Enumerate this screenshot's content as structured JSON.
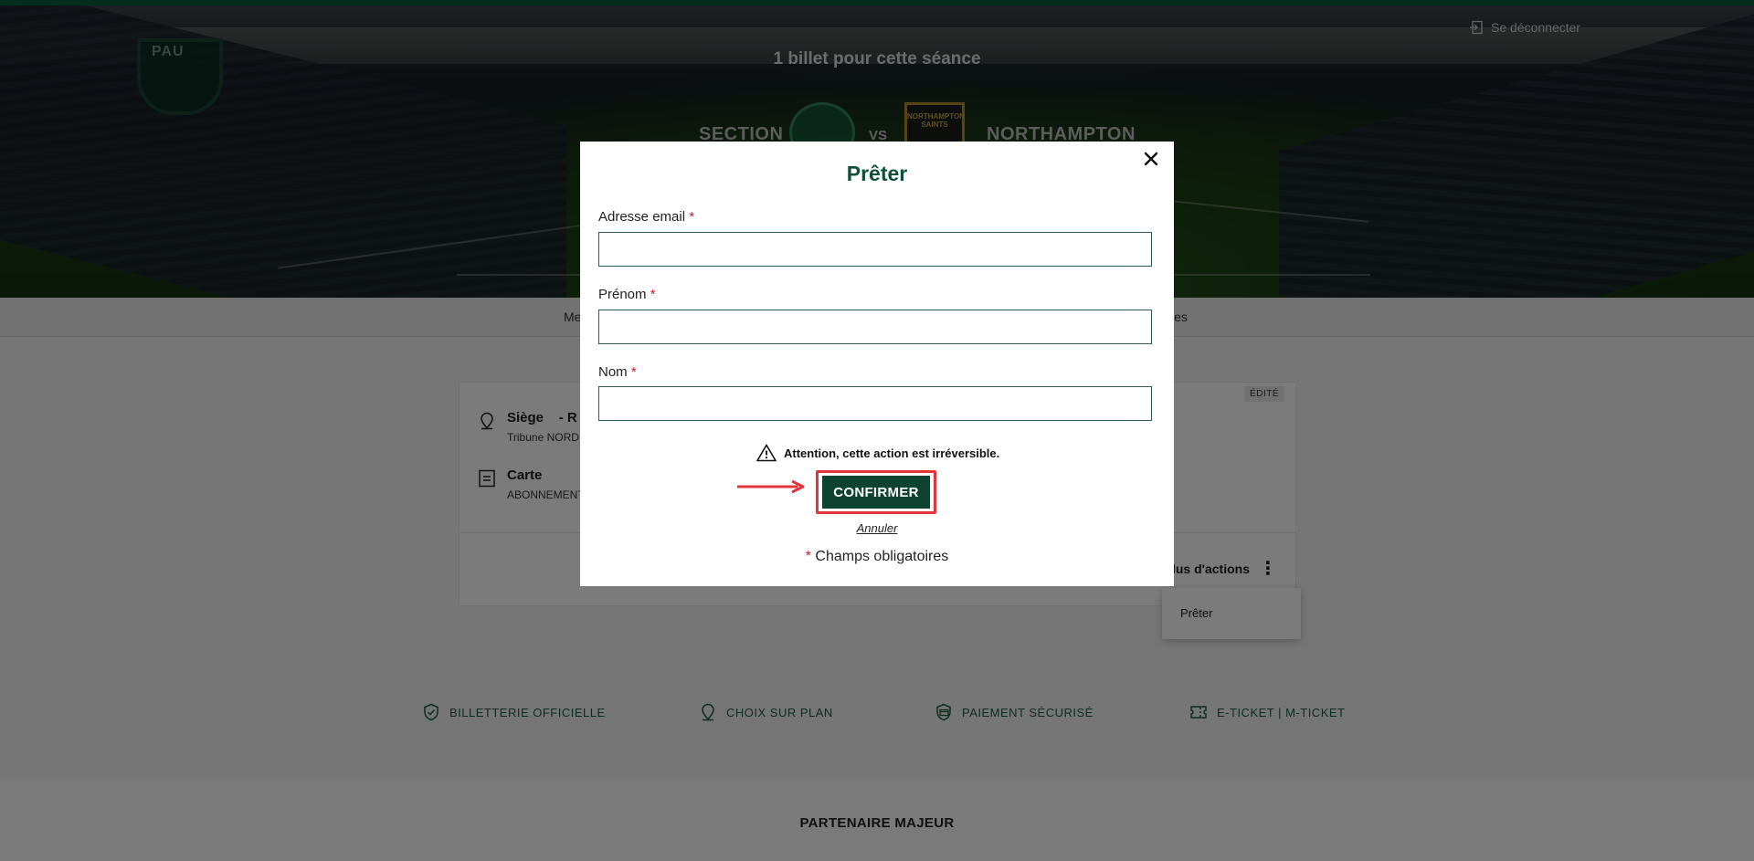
{
  "header": {
    "title": "1 billet pour cette séance",
    "team_home": "SECTION",
    "vs": "VS",
    "team_away": "NORTHAMPTON",
    "away_crest_text": "NORTHAMPTON SAINTS",
    "home_badge_text": "PAU",
    "logout_label": "Se déconnecter"
  },
  "tabs": {
    "left_fragment": "Me",
    "right_fragment": "les"
  },
  "card": {
    "badge": "ÉDITÉ",
    "seat_title": "Siège",
    "seat_suffix": "- R",
    "seat_sub": "Tribune NORD",
    "card_title": "Carte",
    "card_sub": "ABONNEMENT",
    "more_actions": "Plus d'actions",
    "more_dots": "⋮"
  },
  "dropdown": {
    "items": [
      "Prêter"
    ]
  },
  "features": [
    {
      "label": "BILLETTERIE OFFICIELLE",
      "icon": "shield-check-icon"
    },
    {
      "label": "CHOIX SUR PLAN",
      "icon": "map-pin-icon"
    },
    {
      "label": "PAIEMENT SÉCURISÉ",
      "icon": "secure-card-icon"
    },
    {
      "label": "E-TICKET | M-TICKET",
      "icon": "ticket-icon"
    }
  ],
  "partner": {
    "title": "PARTENAIRE MAJEUR"
  },
  "modal": {
    "title": "Prêter",
    "email_label": "Adresse email",
    "firstname_label": "Prénom",
    "lastname_label": "Nom",
    "required_mark": "*",
    "email_value": "",
    "firstname_value": "",
    "lastname_value": "",
    "warning": "Attention, cette action est irréversible.",
    "confirm_label": "CONFIRMER",
    "cancel_label": "Annuler",
    "required_note": "Champs obligatoires"
  },
  "colors": {
    "brand_green": "#0e4231",
    "title_green": "#0e4f37",
    "required_red": "#c21e2d",
    "highlight_red": "#e0353b"
  }
}
